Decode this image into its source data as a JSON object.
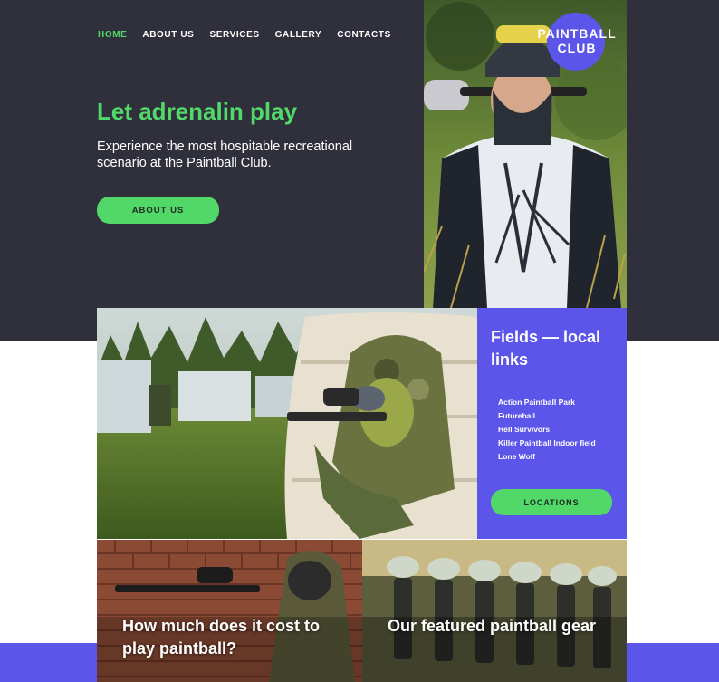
{
  "nav": {
    "items": [
      {
        "label": "HOME",
        "active": true
      },
      {
        "label": "ABOUT US",
        "active": false
      },
      {
        "label": "SERVICES",
        "active": false
      },
      {
        "label": "GALLERY",
        "active": false
      },
      {
        "label": "CONTACTS",
        "active": false
      }
    ]
  },
  "logo": {
    "line1": "PAINTBALL",
    "line2": "CLUB"
  },
  "hero": {
    "title": "Let adrenalin play",
    "text": "Experience the most hospitable recreational scenario at the Paintball Club.",
    "button_label": "ABOUT US"
  },
  "fields": {
    "title": "Fields — local links",
    "links": [
      "Action Paintball Park",
      "Futureball",
      "Hell Survivors",
      "Killer Paintball Indoor field",
      "Lone Wolf"
    ],
    "button_label": "LOCATIONS"
  },
  "tiles": [
    {
      "title": "How much does it cost to play paintball?"
    },
    {
      "title": "Our featured paintball gear"
    }
  ],
  "colors": {
    "dark": "#2f303c",
    "green": "#52d869",
    "purple": "#5b55ea"
  }
}
